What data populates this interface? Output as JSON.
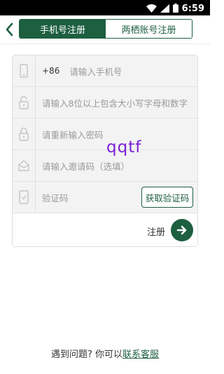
{
  "status_bar": {
    "time": "6:59",
    "icons": [
      "wifi-icon",
      "signal-icon",
      "battery-icon"
    ]
  },
  "header": {
    "tabs": [
      {
        "label": "手机号注册",
        "active": true
      },
      {
        "label": "两栖账号注册",
        "active": false
      }
    ]
  },
  "form": {
    "phone": {
      "prefix": "+86",
      "placeholder": "请输入手机号",
      "icon": "phone-icon"
    },
    "password": {
      "placeholder": "请输入8位以上包含大小写字母和数字",
      "icon": "unlock-icon"
    },
    "confirm_password": {
      "placeholder": "请重新输入密码",
      "icon": "lock-icon"
    },
    "invite_code": {
      "placeholder": "请输入邀请码（选填）",
      "icon": "invite-icon"
    },
    "verify_code": {
      "placeholder": "验证码",
      "icon": "verify-icon",
      "button_label": "获取验证码"
    },
    "submit": {
      "label": "注册",
      "icon": "arrow-right-icon"
    }
  },
  "watermark_text": "qqtf",
  "footer": {
    "text": "遇到问题? 你可以",
    "link": "联系客服"
  },
  "colors": {
    "brand": "#1e5f40",
    "status_bar": "#000000",
    "watermark": "#7b1fd6"
  }
}
